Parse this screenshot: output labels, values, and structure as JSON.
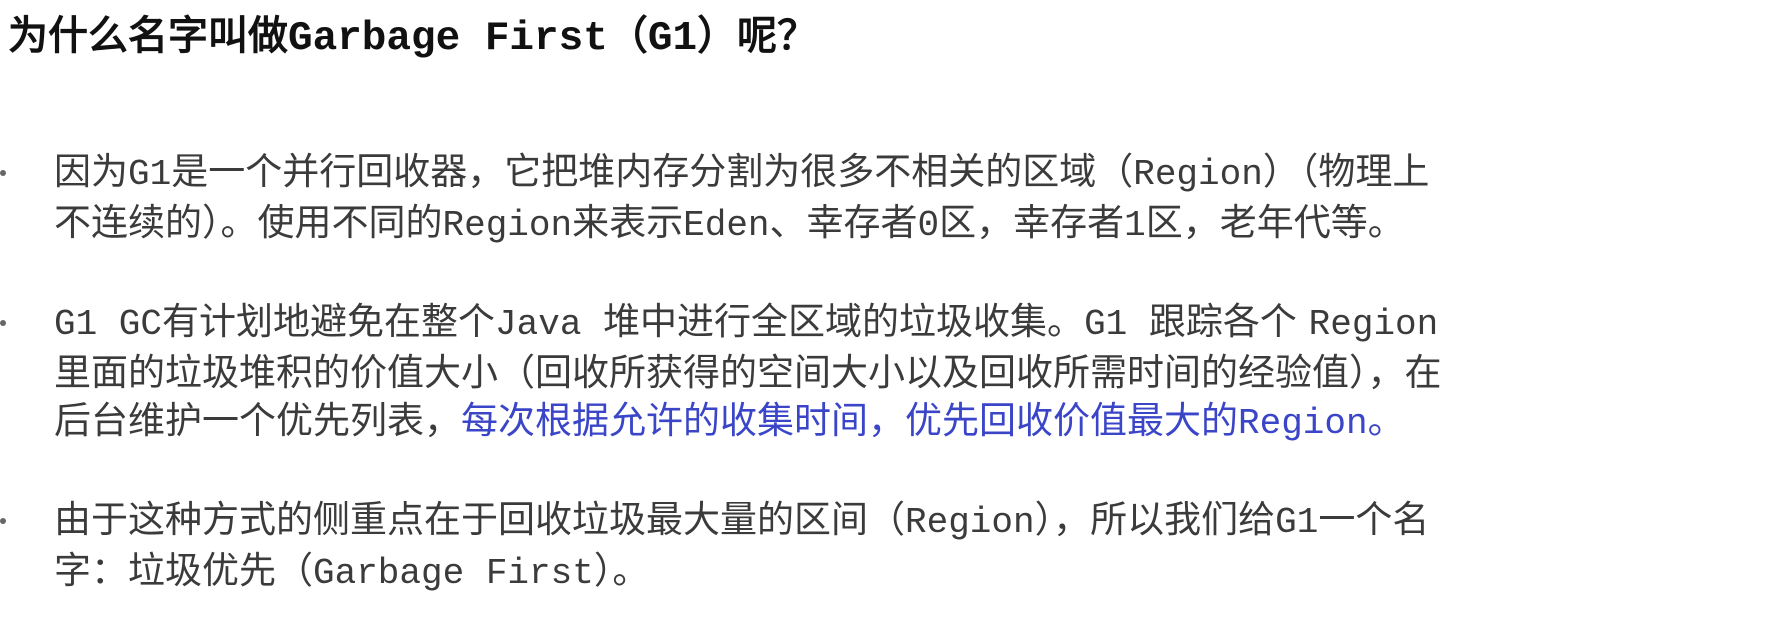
{
  "title": {
    "prefix": "为什么名字叫做",
    "term": "Garbage First",
    "paren_open": "（",
    "abbr": "G1",
    "paren_close": "）",
    "suffix": "呢？"
  },
  "bullets": [
    {
      "line1_a": "因为",
      "line1_b": "G1",
      "line1_c": "是一个并行回收器，它把堆内存分割为很多不相关的区域（",
      "line1_d": "Region",
      "line1_e": "）（物理上",
      "line2_a": "不连续的）。使用不同的",
      "line2_b": "Region",
      "line2_c": "来表示",
      "line2_d": "Eden",
      "line2_e": "、幸存者",
      "line2_f": "0",
      "line2_g": "区，幸存者",
      "line2_h": "1",
      "line2_i": "区，老年代等。"
    },
    {
      "line1_a": "G1 GC",
      "line1_b": "有计划地避免在整个",
      "line1_c": "Java ",
      "line1_d": "堆中进行全区域的垃圾收集。",
      "line1_e": "G1 ",
      "line1_f": "跟踪各个 ",
      "line1_g": "Region",
      "line2_a": "里面的垃圾堆积的价值大小（回收所获得的空间大小以及回收所需时间的经验值），在",
      "line3_a": "后台维护一个优先列表，",
      "line3_b": "每次根据允许的收集时间，优先回收价值最大的",
      "line3_c": "Region",
      "line3_d": "。"
    },
    {
      "line1_a": "由于这种方式的侧重点在于回收垃圾最大量的区间（",
      "line1_b": "Region",
      "line1_c": "），所以我们给",
      "line1_d": "G1",
      "line1_e": "一个名",
      "line2_a": "字：垃圾优先（",
      "line2_b": "Garbage First",
      "line2_c": "）。"
    }
  ],
  "colors": {
    "highlight": "#3a45c8",
    "text": "#3b3b3b"
  }
}
